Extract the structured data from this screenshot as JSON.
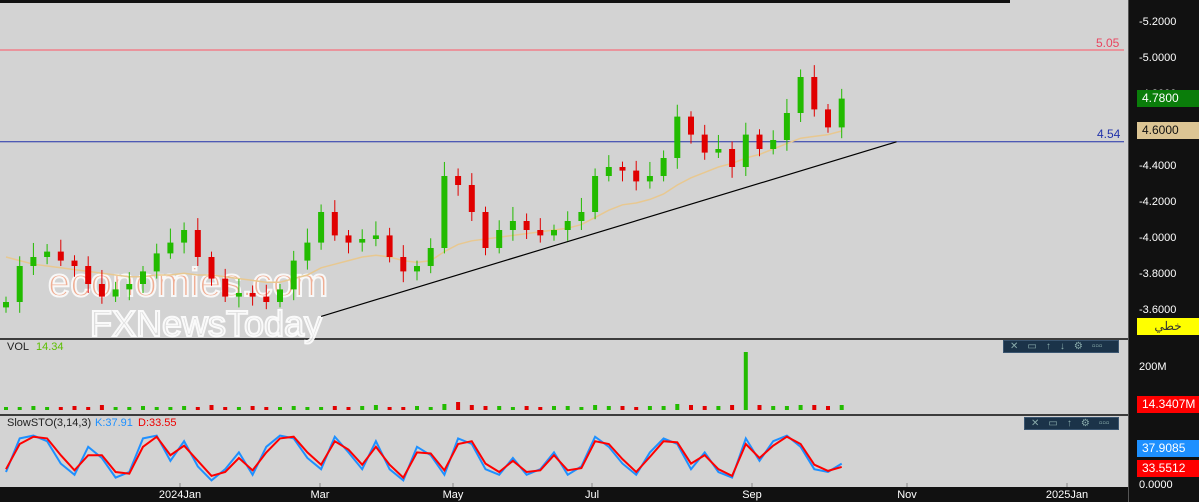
{
  "watermark": {
    "line1": "economies.com",
    "line2": "FXNewsToday"
  },
  "price_panel": {
    "resistance_label": "5.05",
    "support_label": "4.54",
    "last_price": "4.7800",
    "ma_value": "4.6000",
    "draw_tool_label": "خطي"
  },
  "volume_panel": {
    "title": "VOL",
    "value": "14.34",
    "axis_tick": "200M",
    "last_value": "14.3407M"
  },
  "stoch_panel": {
    "title": "SlowSTO(3,14,3)",
    "k_label": "K:37.91",
    "d_label": "D:33.55",
    "k_value": "37.9085",
    "d_value": "33.5512",
    "axis_zero": "0.0000"
  },
  "toolbar_icons": [
    "close",
    "maximize",
    "up",
    "down",
    "settings",
    "more"
  ],
  "colors": {
    "up": "#22bb00",
    "down": "#e00000",
    "ma": "#e8c890",
    "resistance": "#ff5566",
    "support": "#2233aa",
    "k": "#1e90ff",
    "d": "#ff0000"
  },
  "chart_data": {
    "type": "candlestick",
    "price_ticks": [
      "5.2000",
      "5.0000",
      "4.8000",
      "4.6000",
      "4.4000",
      "4.2000",
      "4.0000",
      "3.8000",
      "3.6000"
    ],
    "x_ticks": [
      "2024Jan",
      "Mar",
      "May",
      "Jul",
      "Sep",
      "Nov",
      "2025Jan"
    ],
    "ylim": [
      3.5,
      5.3
    ],
    "resistance": 5.05,
    "support": 4.54,
    "closes": [
      3.65,
      3.85,
      3.9,
      3.93,
      3.88,
      3.85,
      3.75,
      3.68,
      3.72,
      3.75,
      3.82,
      3.92,
      3.98,
      4.05,
      3.9,
      3.78,
      3.68,
      3.7,
      3.68,
      3.65,
      3.72,
      3.88,
      3.98,
      4.15,
      4.02,
      3.98,
      4.0,
      4.02,
      3.9,
      3.82,
      3.85,
      3.95,
      4.35,
      4.3,
      4.15,
      3.95,
      4.05,
      4.1,
      4.05,
      4.02,
      4.05,
      4.1,
      4.15,
      4.35,
      4.4,
      4.38,
      4.32,
      4.35,
      4.45,
      4.68,
      4.58,
      4.48,
      4.5,
      4.4,
      4.58,
      4.5,
      4.55,
      4.7,
      4.9,
      4.72,
      4.62,
      4.78
    ],
    "ma": [
      3.9,
      3.88,
      3.86,
      3.85,
      3.84,
      3.83,
      3.82,
      3.81,
      3.8,
      3.79,
      3.79,
      3.8,
      3.8,
      3.81,
      3.8,
      3.8,
      3.79,
      3.78,
      3.77,
      3.76,
      3.76,
      3.78,
      3.8,
      3.84,
      3.86,
      3.88,
      3.9,
      3.91,
      3.9,
      3.88,
      3.87,
      3.88,
      3.93,
      3.97,
      3.99,
      4.0,
      4.01,
      4.02,
      4.03,
      4.04,
      4.05,
      4.06,
      4.08,
      4.12,
      4.16,
      4.19,
      4.2,
      4.22,
      4.25,
      4.3,
      4.34,
      4.37,
      4.4,
      4.42,
      4.45,
      4.47,
      4.5,
      4.53,
      4.56,
      4.57,
      4.58,
      4.6
    ],
    "trendline": [
      [
        23,
        3.57
      ],
      [
        65,
        4.54
      ]
    ],
    "volume": [
      3,
      3,
      4,
      3,
      3,
      4,
      3,
      5,
      3,
      3,
      4,
      3,
      3,
      4,
      3,
      5,
      3,
      3,
      4,
      3,
      3,
      4,
      3,
      3,
      4,
      3,
      4,
      5,
      3,
      3,
      4,
      3,
      6,
      8,
      5,
      4,
      4,
      3,
      4,
      3,
      4,
      4,
      3,
      5,
      4,
      4,
      3,
      4,
      4,
      6,
      5,
      4,
      4,
      5,
      58,
      5,
      4,
      4,
      5,
      5,
      4,
      5
    ],
    "stoch_k": [
      25,
      85,
      90,
      80,
      40,
      20,
      70,
      50,
      15,
      25,
      85,
      90,
      45,
      80,
      35,
      10,
      30,
      60,
      20,
      70,
      90,
      85,
      50,
      30,
      88,
      60,
      30,
      80,
      30,
      10,
      70,
      55,
      20,
      85,
      75,
      30,
      20,
      50,
      20,
      30,
      60,
      20,
      35,
      88,
      70,
      40,
      20,
      60,
      85,
      75,
      30,
      60,
      25,
      15,
      85,
      45,
      80,
      90,
      70,
      30,
      25,
      40
    ],
    "stoch_d": [
      30,
      75,
      88,
      85,
      55,
      28,
      55,
      55,
      25,
      22,
      70,
      88,
      55,
      72,
      45,
      18,
      25,
      50,
      28,
      60,
      85,
      88,
      60,
      38,
      80,
      65,
      38,
      70,
      38,
      15,
      60,
      58,
      28,
      75,
      80,
      40,
      25,
      45,
      25,
      28,
      55,
      28,
      32,
      80,
      75,
      48,
      25,
      52,
      80,
      78,
      40,
      55,
      30,
      18,
      75,
      50,
      72,
      88,
      75,
      38,
      27,
      34
    ]
  }
}
